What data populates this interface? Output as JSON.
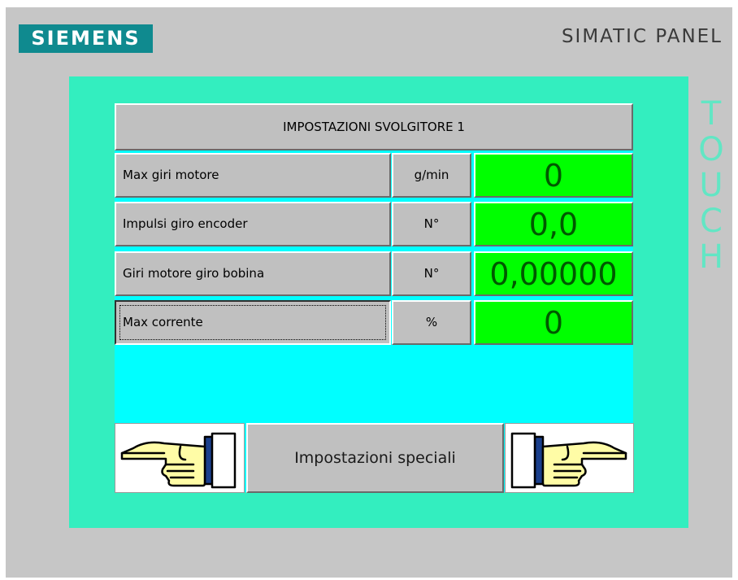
{
  "header": {
    "brand": "SIEMENS",
    "model": "SIMATIC PANEL",
    "side_label_letters": [
      "T",
      "O",
      "U",
      "C",
      "H"
    ]
  },
  "screen": {
    "title": "IMPOSTAZIONI SVOLGITORE 1",
    "rows": [
      {
        "label": "Max giri motore",
        "unit": "g/min",
        "value": "0"
      },
      {
        "label": "Impulsi giro encoder",
        "unit": "N°",
        "value": "0,0"
      },
      {
        "label": "Giri motore giro bobina",
        "unit": "N°",
        "value": "0,00000"
      },
      {
        "label": "Max corrente",
        "unit": "%",
        "value": "0"
      }
    ],
    "special_button": "Impostazioni speciali",
    "nav_left_icon": "hand-pointing-left-icon",
    "nav_right_icon": "hand-pointing-right-icon"
  },
  "colors": {
    "frame": "#c6c6c6",
    "screen_background": "#33eebf",
    "cyan_background": "#00ffff",
    "value_field": "#00ff00",
    "brand": "#0f8a8f"
  }
}
